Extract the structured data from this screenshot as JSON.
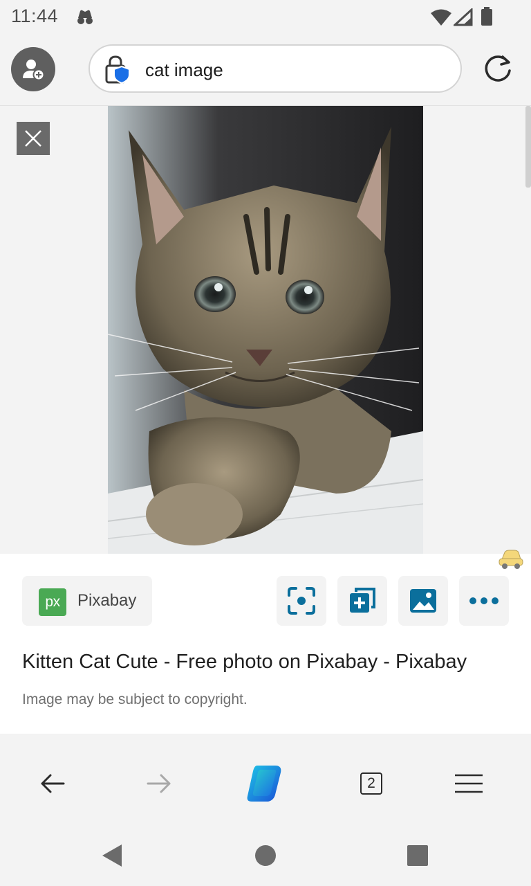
{
  "status_bar": {
    "time": "11:44"
  },
  "address_bar": {
    "url_text": "cat image"
  },
  "viewer": {
    "image_alt": "Tabby kitten reaching toward camera"
  },
  "info": {
    "source_name": "Pixabay",
    "source_logo_text": "px",
    "title": "Kitten Cat Cute - Free photo on Pixabay - Pixabay",
    "copyright_note": "Image may be subject to copyright."
  },
  "toolbar": {
    "tab_count": "2"
  },
  "colors": {
    "accent": "#0b6f9c",
    "logo_green": "#4aa954",
    "background": "#f3f3f3"
  }
}
